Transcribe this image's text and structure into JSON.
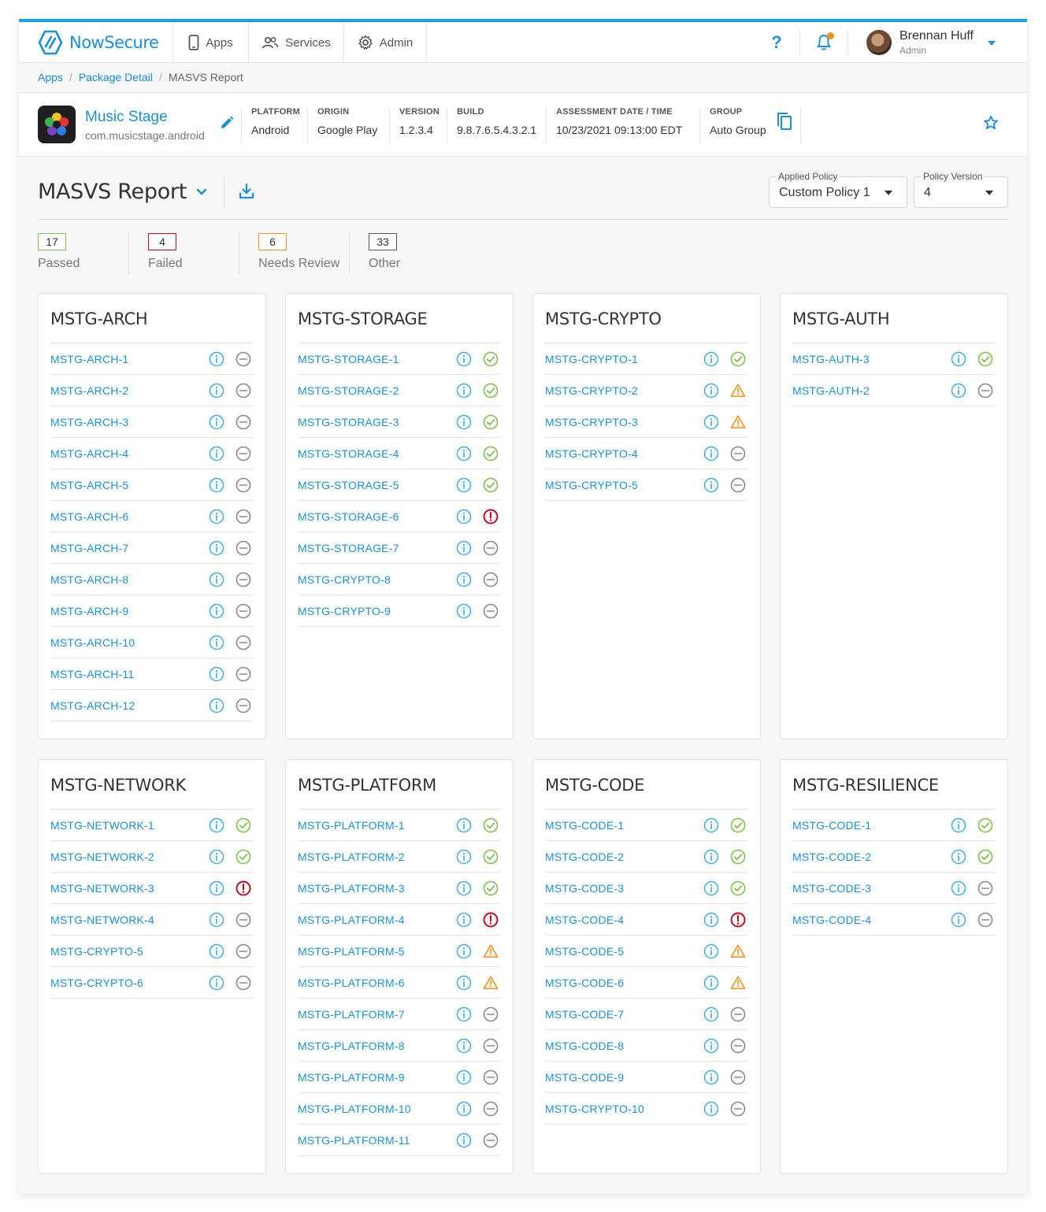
{
  "brand": {
    "name": "NowSecure",
    "color": "#1a8fe0"
  },
  "nav": {
    "items": [
      {
        "label": "Apps",
        "icon": "phone-icon"
      },
      {
        "label": "Services",
        "icon": "users-icon"
      },
      {
        "label": "Admin",
        "icon": "gear-icon"
      }
    ],
    "help_label": "?",
    "user": {
      "name": "Brennan Huff",
      "role": "Admin"
    }
  },
  "breadcrumb": {
    "items": [
      "Apps",
      "Package Detail"
    ],
    "current": "MASVS Report"
  },
  "app": {
    "name": "Music Stage",
    "package": "com.musicstage.android",
    "meta": [
      {
        "label": "PLATFORM",
        "value": "Android"
      },
      {
        "label": "ORIGIN",
        "value": "Google Play"
      },
      {
        "label": "VERSION",
        "value": "1.2.3.4"
      },
      {
        "label": "BUILD",
        "value": "9.8.7.6.5.4.3.2.1"
      },
      {
        "label": "ASSESSMENT DATE / TIME",
        "value": "10/23/2021 09:13:00 EDT"
      },
      {
        "label": "GROUP",
        "value": "Auto Group"
      }
    ]
  },
  "report": {
    "title": "MASVS Report",
    "applied_policy": {
      "label": "Applied Policy",
      "value": "Custom Policy 1"
    },
    "policy_version": {
      "label": "Policy Version",
      "value": "4"
    }
  },
  "summary": [
    {
      "count": "17",
      "label": "Passed",
      "color": "#7cc34a"
    },
    {
      "count": "4",
      "label": "Failed",
      "color": "#d0021b"
    },
    {
      "count": "6",
      "label": "Needs Review",
      "color": "#f0941d"
    },
    {
      "count": "33",
      "label": "Other",
      "color": "#555555"
    }
  ],
  "status_colors": {
    "pass": "#7cc34a",
    "fail": "#c0001a",
    "warn": "#f0941d",
    "other": "#8a8a8a",
    "info": "#39aee8"
  },
  "cards": [
    {
      "title": "MSTG-ARCH",
      "rows": [
        {
          "label": "MSTG-ARCH-1",
          "status": "other"
        },
        {
          "label": "MSTG-ARCH-2",
          "status": "other"
        },
        {
          "label": "MSTG-ARCH-3",
          "status": "other"
        },
        {
          "label": "MSTG-ARCH-4",
          "status": "other"
        },
        {
          "label": "MSTG-ARCH-5",
          "status": "other"
        },
        {
          "label": "MSTG-ARCH-6",
          "status": "other"
        },
        {
          "label": "MSTG-ARCH-7",
          "status": "other"
        },
        {
          "label": "MSTG-ARCH-8",
          "status": "other"
        },
        {
          "label": "MSTG-ARCH-9",
          "status": "other"
        },
        {
          "label": "MSTG-ARCH-10",
          "status": "other"
        },
        {
          "label": "MSTG-ARCH-11",
          "status": "other"
        },
        {
          "label": "MSTG-ARCH-12",
          "status": "other"
        }
      ]
    },
    {
      "title": "MSTG-STORAGE",
      "rows": [
        {
          "label": "MSTG-STORAGE-1",
          "status": "pass"
        },
        {
          "label": "MSTG-STORAGE-2",
          "status": "pass"
        },
        {
          "label": "MSTG-STORAGE-3",
          "status": "pass"
        },
        {
          "label": "MSTG-STORAGE-4",
          "status": "pass"
        },
        {
          "label": "MSTG-STORAGE-5",
          "status": "pass"
        },
        {
          "label": "MSTG-STORAGE-6",
          "status": "fail"
        },
        {
          "label": "MSTG-STORAGE-7",
          "status": "other"
        },
        {
          "label": "MSTG-CRYPTO-8",
          "status": "other"
        },
        {
          "label": "MSTG-CRYPTO-9",
          "status": "other"
        }
      ]
    },
    {
      "title": "MSTG-CRYPTO",
      "rows": [
        {
          "label": "MSTG-CRYPTO-1",
          "status": "pass"
        },
        {
          "label": "MSTG-CRYPTO-2",
          "status": "warn"
        },
        {
          "label": "MSTG-CRYPTO-3",
          "status": "warn"
        },
        {
          "label": "MSTG-CRYPTO-4",
          "status": "other"
        },
        {
          "label": "MSTG-CRYPTO-5",
          "status": "other"
        }
      ]
    },
    {
      "title": "MSTG-AUTH",
      "rows": [
        {
          "label": "MSTG-AUTH-3",
          "status": "pass"
        },
        {
          "label": "MSTG-AUTH-2",
          "status": "other"
        }
      ]
    },
    {
      "title": "MSTG-NETWORK",
      "rows": [
        {
          "label": "MSTG-NETWORK-1",
          "status": "pass"
        },
        {
          "label": "MSTG-NETWORK-2",
          "status": "pass"
        },
        {
          "label": "MSTG-NETWORK-3",
          "status": "fail"
        },
        {
          "label": "MSTG-NETWORK-4",
          "status": "other"
        },
        {
          "label": "MSTG-CRYPTO-5",
          "status": "other"
        },
        {
          "label": "MSTG-CRYPTO-6",
          "status": "other"
        }
      ]
    },
    {
      "title": "MSTG-PLATFORM",
      "rows": [
        {
          "label": "MSTG-PLATFORM-1",
          "status": "pass"
        },
        {
          "label": "MSTG-PLATFORM-2",
          "status": "pass"
        },
        {
          "label": "MSTG-PLATFORM-3",
          "status": "pass"
        },
        {
          "label": "MSTG-PLATFORM-4",
          "status": "fail"
        },
        {
          "label": "MSTG-PLATFORM-5",
          "status": "warn"
        },
        {
          "label": "MSTG-PLATFORM-6",
          "status": "warn"
        },
        {
          "label": "MSTG-PLATFORM-7",
          "status": "other"
        },
        {
          "label": "MSTG-PLATFORM-8",
          "status": "other"
        },
        {
          "label": "MSTG-PLATFORM-9",
          "status": "other"
        },
        {
          "label": "MSTG-PLATFORM-10",
          "status": "other"
        },
        {
          "label": "MSTG-PLATFORM-11",
          "status": "other"
        }
      ]
    },
    {
      "title": "MSTG-CODE",
      "rows": [
        {
          "label": "MSTG-CODE-1",
          "status": "pass"
        },
        {
          "label": "MSTG-CODE-2",
          "status": "pass"
        },
        {
          "label": "MSTG-CODE-3",
          "status": "pass"
        },
        {
          "label": "MSTG-CODE-4",
          "status": "fail"
        },
        {
          "label": "MSTG-CODE-5",
          "status": "warn"
        },
        {
          "label": "MSTG-CODE-6",
          "status": "warn"
        },
        {
          "label": "MSTG-CODE-7",
          "status": "other"
        },
        {
          "label": "MSTG-CODE-8",
          "status": "other"
        },
        {
          "label": "MSTG-CODE-9",
          "status": "other"
        },
        {
          "label": "MSTG-CRYPTO-10",
          "status": "other"
        }
      ]
    },
    {
      "title": "MSTG-RESILIENCE",
      "rows": [
        {
          "label": "MSTG-CODE-1",
          "status": "pass"
        },
        {
          "label": "MSTG-CODE-2",
          "status": "pass"
        },
        {
          "label": "MSTG-CODE-3",
          "status": "other"
        },
        {
          "label": "MSTG-CODE-4",
          "status": "other"
        }
      ]
    }
  ]
}
